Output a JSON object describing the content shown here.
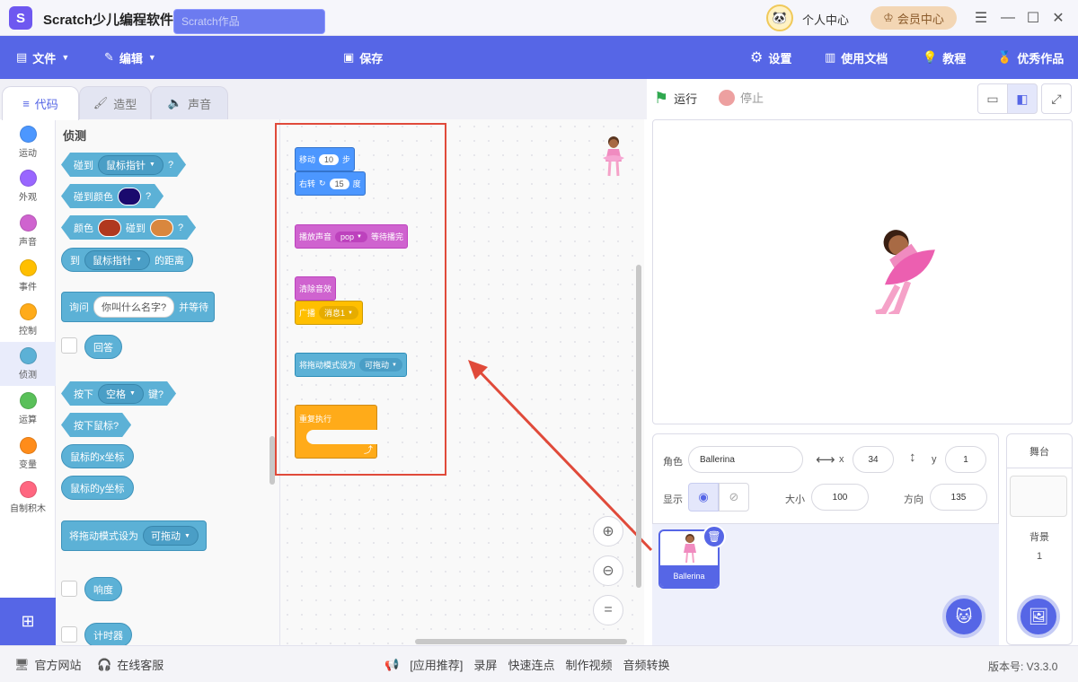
{
  "app": {
    "title": "Scratch少儿编程软件",
    "logo_icon": "scratch-logo-icon"
  },
  "titlebar": {
    "personal": "个人中心",
    "vip": "会员中心"
  },
  "toolbar": {
    "file": "文件",
    "edit": "编辑",
    "project_placeholder": "Scratch作品",
    "save": "保存",
    "settings": "设置",
    "docs": "使用文档",
    "tutorial": "教程",
    "showcase": "优秀作品"
  },
  "tabs": {
    "code": "代码",
    "costume": "造型",
    "sound": "声音"
  },
  "categories": [
    {
      "label": "运动",
      "color": "#4c97ff"
    },
    {
      "label": "外观",
      "color": "#9966ff"
    },
    {
      "label": "声音",
      "color": "#cf63cf"
    },
    {
      "label": "事件",
      "color": "#ffbf00"
    },
    {
      "label": "控制",
      "color": "#ffab19"
    },
    {
      "label": "侦测",
      "color": "#5cb1d6"
    },
    {
      "label": "运算",
      "color": "#59c059"
    },
    {
      "label": "变量",
      "color": "#ff8c1a"
    },
    {
      "label": "自制积木",
      "color": "#ff6680"
    }
  ],
  "palette": {
    "title": "侦测",
    "touching": {
      "pre": "碰到",
      "opt": "鼠标指针",
      "q": "?"
    },
    "touching_color": {
      "pre": "碰到颜色",
      "q": "?",
      "swatch": "#1a0a6e"
    },
    "color_touching": {
      "pre": "颜色",
      "mid": "碰到",
      "q": "?",
      "c1": "#b0381f",
      "c2": "#d9873e"
    },
    "distance": {
      "pre": "到",
      "opt": "鼠标指针",
      "post": "的距离"
    },
    "ask": {
      "pre": "询问",
      "field": "你叫什么名字?",
      "post": "并等待"
    },
    "answer": "回答",
    "key_pressed": {
      "pre": "按下",
      "opt": "空格",
      "post": "键?"
    },
    "mouse_down": "按下鼠标?",
    "mouse_x": "鼠标的x坐标",
    "mouse_y": "鼠标的y坐标",
    "drag_mode": {
      "pre": "将拖动模式设为",
      "opt": "可拖动"
    },
    "loudness": "响度",
    "timer": "计时器"
  },
  "script": {
    "move": {
      "pre": "移动",
      "val": "10",
      "post": "步"
    },
    "turn": {
      "pre": "右转",
      "val": "15",
      "post": "度"
    },
    "play_sound": {
      "pre": "播放声音",
      "opt": "pop",
      "post": "等待播完"
    },
    "clear_effects": "清除音效",
    "broadcast": {
      "pre": "广播",
      "opt": "消息1"
    },
    "drag_mode": {
      "pre": "将拖动模式设为",
      "opt": "可拖动"
    },
    "forever": "重复执行"
  },
  "stage": {
    "run": "运行",
    "stop": "停止"
  },
  "sprite": {
    "label_sprite": "角色",
    "name": "Ballerina",
    "x_label": "x",
    "x": "34",
    "y_label": "y",
    "y": "1",
    "show_label": "显示",
    "size_label": "大小",
    "size": "100",
    "direction_label": "方向",
    "direction": "135",
    "card_name": "Ballerina"
  },
  "stage_panel": {
    "title": "舞台",
    "backdrops_label": "背景",
    "backdrops_count": "1"
  },
  "footer": {
    "website": "官方网站",
    "support": "在线客服",
    "recommend": "[应用推荐]",
    "record": "录屏",
    "quick_link": "快速连点",
    "make_video": "制作视频",
    "audio_convert": "音频转换",
    "version": "版本号: V3.3.0"
  },
  "colors": {
    "accent": "#5666e6",
    "highlight_box": "#e04a3a",
    "sensing": "#5cb1d6"
  }
}
